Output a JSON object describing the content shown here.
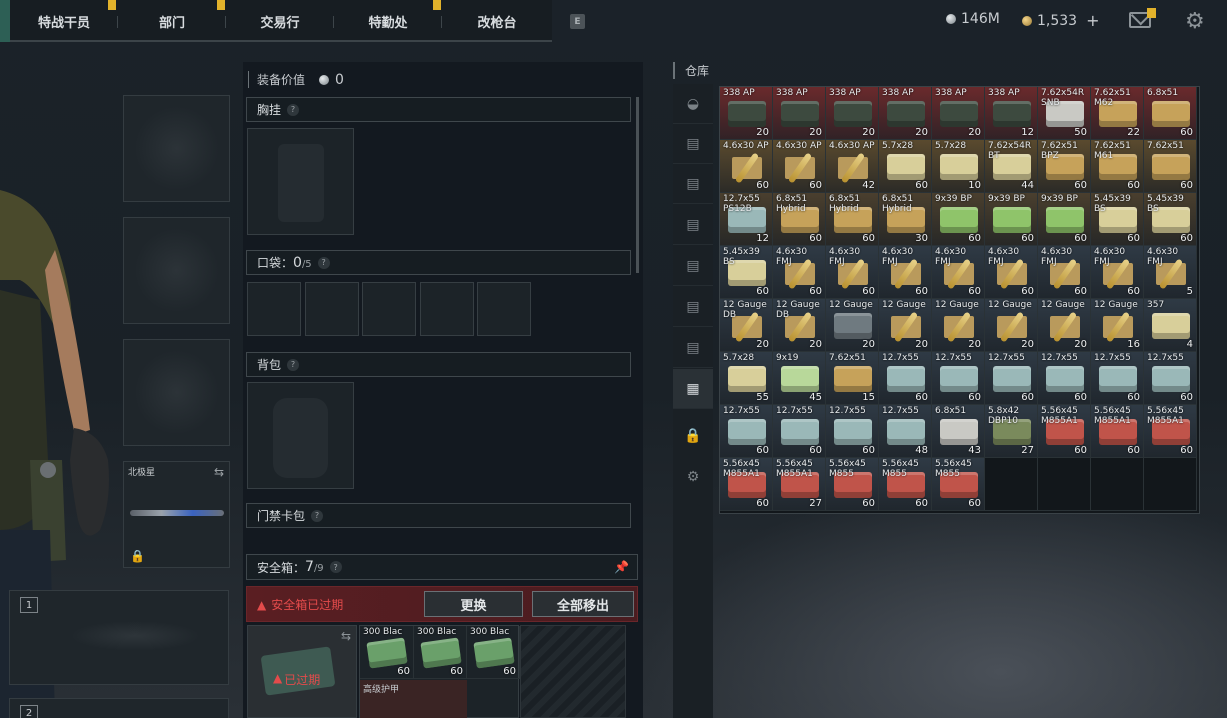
{
  "nav": {
    "tabs": [
      {
        "label": "特战干员",
        "badge": true
      },
      {
        "label": "部门",
        "badge": true
      },
      {
        "label": "交易行",
        "badge": false
      },
      {
        "label": "特勤处",
        "badge": true
      },
      {
        "label": "改枪台",
        "badge": false
      }
    ],
    "key_hint": "E"
  },
  "currency": {
    "silver": "146M",
    "gold": "1,533",
    "plus": "+"
  },
  "slots": {
    "melee_label": "北极星",
    "weapon1_num": "1",
    "weapon2_num": "2"
  },
  "equipment": {
    "title": "装备价值",
    "value": "0",
    "chest_rig": "胸挂",
    "pockets_label": "口袋：",
    "pockets_used": "0",
    "pockets_total": "/5",
    "backpack": "背包",
    "keycard": "门禁卡包",
    "help": "?"
  },
  "safebox": {
    "label": "安全箱：",
    "used": "7",
    "total": "/9",
    "expired_warning": "安全箱已过期",
    "replace_button": "更换",
    "move_all_button": "全部移出",
    "expired_tag": "已过期",
    "items": [
      "300 Blac",
      "300 Blac",
      "300 Blac"
    ],
    "item_count": "60",
    "sub_label": "高级护甲"
  },
  "warehouse": {
    "title": "仓库",
    "items": [
      {
        "name": "338 AP",
        "count": "20",
        "color": "#3d4a3f",
        "bg": "#6a2a2c"
      },
      {
        "name": "338 AP",
        "count": "20",
        "color": "#3d4a3f",
        "bg": "#6a2a2c"
      },
      {
        "name": "338 AP",
        "count": "20",
        "color": "#3d4a3f",
        "bg": "#6a2a2c"
      },
      {
        "name": "338 AP",
        "count": "20",
        "color": "#3d4a3f",
        "bg": "#6a2a2c"
      },
      {
        "name": "338 AP",
        "count": "20",
        "color": "#3d4a3f",
        "bg": "#6a2a2c"
      },
      {
        "name": "338 AP",
        "count": "12",
        "color": "#3d4a3f",
        "bg": "#6a2a2c"
      },
      {
        "name": "7.62x54R SNB",
        "count": "50",
        "color": "#c9c9c4",
        "bg": "#6a2a2c"
      },
      {
        "name": "7.62x51 M62",
        "count": "22",
        "color": "#c6a25a",
        "bg": "#6a2a2c"
      },
      {
        "name": "6.8x51",
        "count": "60",
        "color": "#c6a25a",
        "bg": "#6a2a2c"
      },
      {
        "name": "4.6x30 AP",
        "count": "60",
        "color": "bullet",
        "bg": "#5a4a2e"
      },
      {
        "name": "4.6x30 AP",
        "count": "60",
        "color": "bullet",
        "bg": "#5a4a2e"
      },
      {
        "name": "4.6x30 AP",
        "count": "42",
        "color": "bullet",
        "bg": "#5a4a2e"
      },
      {
        "name": "5.7x28",
        "count": "60",
        "color": "#d8cf9a",
        "bg": "#5a4a2e"
      },
      {
        "name": "5.7x28",
        "count": "10",
        "color": "#d8cf9a",
        "bg": "#5a4a2e"
      },
      {
        "name": "7.62x54R BT",
        "count": "44",
        "color": "#d8cf9a",
        "bg": "#5a4a2e"
      },
      {
        "name": "7.62x51 BPZ",
        "count": "60",
        "color": "#c6a25a",
        "bg": "#5a4a2e"
      },
      {
        "name": "7.62x51 M61",
        "count": "60",
        "color": "#c6a25a",
        "bg": "#5a4a2e"
      },
      {
        "name": "7.62x51",
        "count": "60",
        "color": "#c6a25a",
        "bg": "#5a4a2e"
      },
      {
        "name": "12.7x55 PS12B",
        "count": "12",
        "color": "#9ab8b8",
        "bg": "#4a3f2e"
      },
      {
        "name": "6.8x51 Hybrid",
        "count": "60",
        "color": "#c6a25a",
        "bg": "#4a3f2e"
      },
      {
        "name": "6.8x51 Hybrid",
        "count": "60",
        "color": "#c6a25a",
        "bg": "#4a3f2e"
      },
      {
        "name": "6.8x51 Hybrid",
        "count": "30",
        "color": "#c6a25a",
        "bg": "#4a3f2e"
      },
      {
        "name": "9x39 BP",
        "count": "60",
        "color": "#8fc46a",
        "bg": "#4a3f2e"
      },
      {
        "name": "9x39 BP",
        "count": "60",
        "color": "#8fc46a",
        "bg": "#4a3f2e"
      },
      {
        "name": "9x39 BP",
        "count": "60",
        "color": "#8fc46a",
        "bg": "#4a3f2e"
      },
      {
        "name": "5.45x39 BS",
        "count": "60",
        "color": "#d8cf9a",
        "bg": "#4a3f2e"
      },
      {
        "name": "5.45x39 BS",
        "count": "60",
        "color": "#d8cf9a",
        "bg": "#4a3f2e"
      },
      {
        "name": "5.45x39 BS",
        "count": "60",
        "color": "#d8cf9a",
        "bg": "#2f3a45"
      },
      {
        "name": "4.6x30 FMJ",
        "count": "60",
        "color": "bullet",
        "bg": "#2f3a45"
      },
      {
        "name": "4.6x30 FMJ",
        "count": "60",
        "color": "bullet",
        "bg": "#2f3a45"
      },
      {
        "name": "4.6x30 FMJ",
        "count": "60",
        "color": "bullet",
        "bg": "#2f3a45"
      },
      {
        "name": "4.6x30 FMJ",
        "count": "60",
        "color": "bullet",
        "bg": "#2f3a45"
      },
      {
        "name": "4.6x30 FMJ",
        "count": "60",
        "color": "bullet",
        "bg": "#2f3a45"
      },
      {
        "name": "4.6x30 FMJ",
        "count": "60",
        "color": "bullet",
        "bg": "#2f3a45"
      },
      {
        "name": "4.6x30 FMJ",
        "count": "60",
        "color": "bullet",
        "bg": "#2f3a45"
      },
      {
        "name": "4.6x30 FMJ",
        "count": "5",
        "color": "bullet",
        "bg": "#2f3a45"
      },
      {
        "name": "12 Gauge DB",
        "count": "20",
        "color": "bullet",
        "bg": "#2f3a45"
      },
      {
        "name": "12 Gauge DB",
        "count": "20",
        "color": "bullet",
        "bg": "#2f3a45"
      },
      {
        "name": "12 Gauge",
        "count": "20",
        "color": "#6f7a80",
        "bg": "#2f3a45"
      },
      {
        "name": "12 Gauge",
        "count": "20",
        "color": "bullet",
        "bg": "#2f3a45"
      },
      {
        "name": "12 Gauge",
        "count": "20",
        "color": "bullet",
        "bg": "#2f3a45"
      },
      {
        "name": "12 Gauge",
        "count": "20",
        "color": "bullet",
        "bg": "#2f3a45"
      },
      {
        "name": "12 Gauge",
        "count": "20",
        "color": "bullet",
        "bg": "#2f3a45"
      },
      {
        "name": "12 Gauge",
        "count": "16",
        "color": "bullet",
        "bg": "#2f3a45"
      },
      {
        "name": "357",
        "count": "4",
        "color": "#d8cf9a",
        "bg": "#2f3a45"
      },
      {
        "name": "5.7x28",
        "count": "55",
        "color": "#d8cf9a",
        "bg": "#2f3a45"
      },
      {
        "name": "9x19",
        "count": "45",
        "color": "#b8d89a",
        "bg": "#2f3a45"
      },
      {
        "name": "7.62x51",
        "count": "15",
        "color": "#c6a25a",
        "bg": "#2f3a45"
      },
      {
        "name": "12.7x55",
        "count": "60",
        "color": "#9ab8b8",
        "bg": "#2f3a45"
      },
      {
        "name": "12.7x55",
        "count": "60",
        "color": "#9ab8b8",
        "bg": "#2f3a45"
      },
      {
        "name": "12.7x55",
        "count": "60",
        "color": "#9ab8b8",
        "bg": "#2f3a45"
      },
      {
        "name": "12.7x55",
        "count": "60",
        "color": "#9ab8b8",
        "bg": "#2f3a45"
      },
      {
        "name": "12.7x55",
        "count": "60",
        "color": "#9ab8b8",
        "bg": "#2f3a45"
      },
      {
        "name": "12.7x55",
        "count": "60",
        "color": "#9ab8b8",
        "bg": "#2f3a45"
      },
      {
        "name": "12.7x55",
        "count": "60",
        "color": "#9ab8b8",
        "bg": "#2f3a45"
      },
      {
        "name": "12.7x55",
        "count": "60",
        "color": "#9ab8b8",
        "bg": "#2f3a45"
      },
      {
        "name": "12.7x55",
        "count": "60",
        "color": "#9ab8b8",
        "bg": "#2f3a45"
      },
      {
        "name": "12.7x55",
        "count": "48",
        "color": "#9ab8b8",
        "bg": "#2f3a45"
      },
      {
        "name": "6.8x51",
        "count": "43",
        "color": "#c9c9c4",
        "bg": "#2f3a45"
      },
      {
        "name": "5.8x42 DBP10",
        "count": "27",
        "color": "#7a8a5c",
        "bg": "#2f3a45"
      },
      {
        "name": "5.56x45 M855A1",
        "count": "60",
        "color": "#c0544a",
        "bg": "#2f3a45"
      },
      {
        "name": "5.56x45 M855A1",
        "count": "60",
        "color": "#c0544a",
        "bg": "#2f3a45"
      },
      {
        "name": "5.56x45 M855A1",
        "count": "60",
        "color": "#c0544a",
        "bg": "#2f3a45"
      },
      {
        "name": "5.56x45 M855A1",
        "count": "60",
        "color": "#c0544a",
        "bg": "#2f3a45"
      },
      {
        "name": "5.56x45 M855A1",
        "count": "27",
        "color": "#c0544a",
        "bg": "#2f3a45"
      },
      {
        "name": "5.56x45 M855",
        "count": "60",
        "color": "#c0544a",
        "bg": "#2f3a45"
      },
      {
        "name": "5.56x45 M855",
        "count": "60",
        "color": "#c0544a",
        "bg": "#2f3a45"
      },
      {
        "name": "5.56x45 M855",
        "count": "60",
        "color": "#c0544a",
        "bg": "#2f3a45"
      }
    ]
  }
}
